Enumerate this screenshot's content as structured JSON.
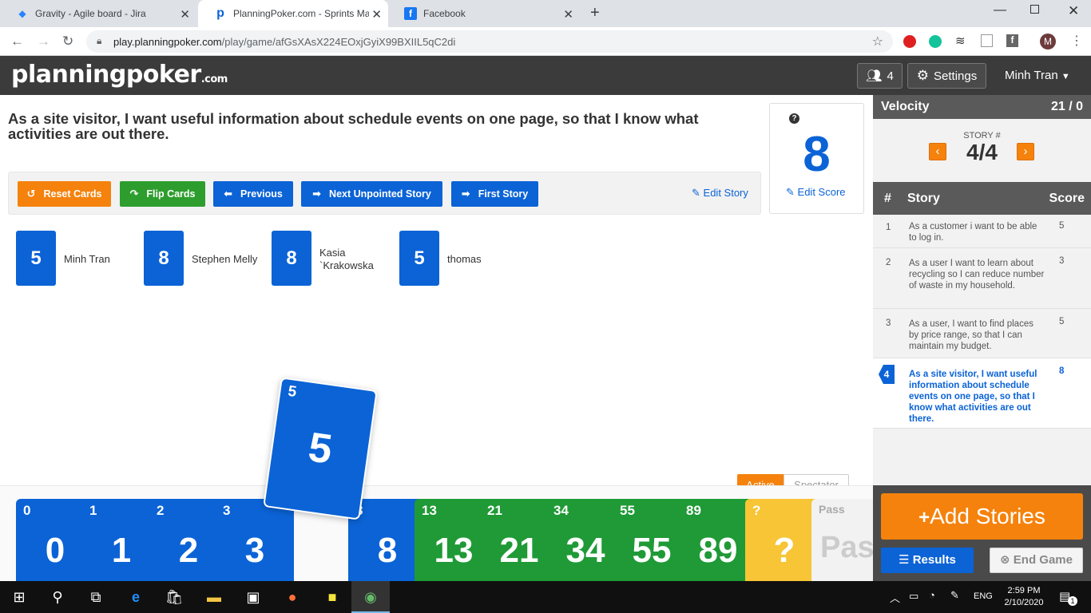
{
  "browser": {
    "tabs": [
      {
        "title": "Gravity - Agile board - Jira",
        "icon": "jira-icon",
        "active": false
      },
      {
        "title": "PlanningPoker.com - Sprints Mad",
        "icon": "planningpoker-icon",
        "active": true
      },
      {
        "title": "Facebook",
        "icon": "facebook-icon",
        "active": false
      }
    ],
    "url_host": "play.planningpoker.com",
    "url_path": "/play/game/afGsXAsX224EOxjGyiX99BXIIL5qC2di",
    "profile_initial": "M"
  },
  "header": {
    "logo_main": "planningpoker",
    "logo_suffix": ".com",
    "players_count": "4",
    "settings_label": "Settings",
    "user_name": "Minh Tran"
  },
  "story": {
    "title": "As a site visitor, I want useful information about schedule events on one page, so that I know what activities are out there.",
    "score": "8",
    "score_help": "?",
    "edit_score_label": "Edit Score",
    "edit_story_label": "Edit Story"
  },
  "toolbar": {
    "reset_label": "Reset Cards",
    "flip_label": "Flip Cards",
    "previous_label": "Previous",
    "next_unpointed_label": "Next Unpointed Story",
    "first_story_label": "First Story"
  },
  "players": [
    {
      "vote": "5",
      "name": "Minh Tran"
    },
    {
      "vote": "8",
      "name": "Stephen Melly"
    },
    {
      "vote": "8",
      "name_line1": "Kasia",
      "name_line2": "`Krakowska"
    },
    {
      "vote": "5",
      "name": "thomas"
    }
  ],
  "selected_card": {
    "corner": "5",
    "value": "5"
  },
  "role_toggle": {
    "active_label": "Active",
    "spectator_label": "Spectator"
  },
  "deck": [
    {
      "corner": "0",
      "value": "0"
    },
    {
      "corner": "1",
      "value": "1"
    },
    {
      "corner": "2",
      "value": "2"
    },
    {
      "corner": "3",
      "value": "3"
    },
    {
      "corner": "8",
      "value": "8"
    },
    {
      "corner": "13",
      "value": "13"
    },
    {
      "corner": "21",
      "value": "21"
    },
    {
      "corner": "34",
      "value": "34"
    },
    {
      "corner": "55",
      "value": "55"
    },
    {
      "corner": "89",
      "value": "89"
    },
    {
      "corner": "?",
      "value": "?"
    },
    {
      "corner": "Pass",
      "value": "Pass"
    }
  ],
  "sidebar": {
    "velocity_label": "Velocity",
    "velocity_value": "21 / 0",
    "story_num_label": "STORY #",
    "story_num_value": "4/4",
    "col_num": "#",
    "col_story": "Story",
    "col_score": "Score",
    "stories": [
      {
        "num": "1",
        "text": "As a customer i want to be able to log in.",
        "score": "5"
      },
      {
        "num": "2",
        "text": "As a user I want to learn about recycling so I can reduce number of waste in my household.",
        "score": "3"
      },
      {
        "num": "3",
        "text": "As a user, I want to find places by price range, so that I can maintain my budget.",
        "score": "5"
      },
      {
        "num": "4",
        "text": "As a site visitor, I want useful information about schedule events on one page, so that I know what activities are out there.",
        "score": "8"
      }
    ],
    "add_stories_label": "Add Stories",
    "results_label": "Results",
    "end_game_label": "End Game"
  },
  "taskbar": {
    "time": "2:59 PM",
    "date": "2/10/2020",
    "lang": "ENG",
    "notif_count": "1"
  },
  "colors": {
    "orange": "#f5820c",
    "green": "#2d9e2d",
    "blue": "#0b63d6",
    "dark_header": "#3b3b3b"
  }
}
